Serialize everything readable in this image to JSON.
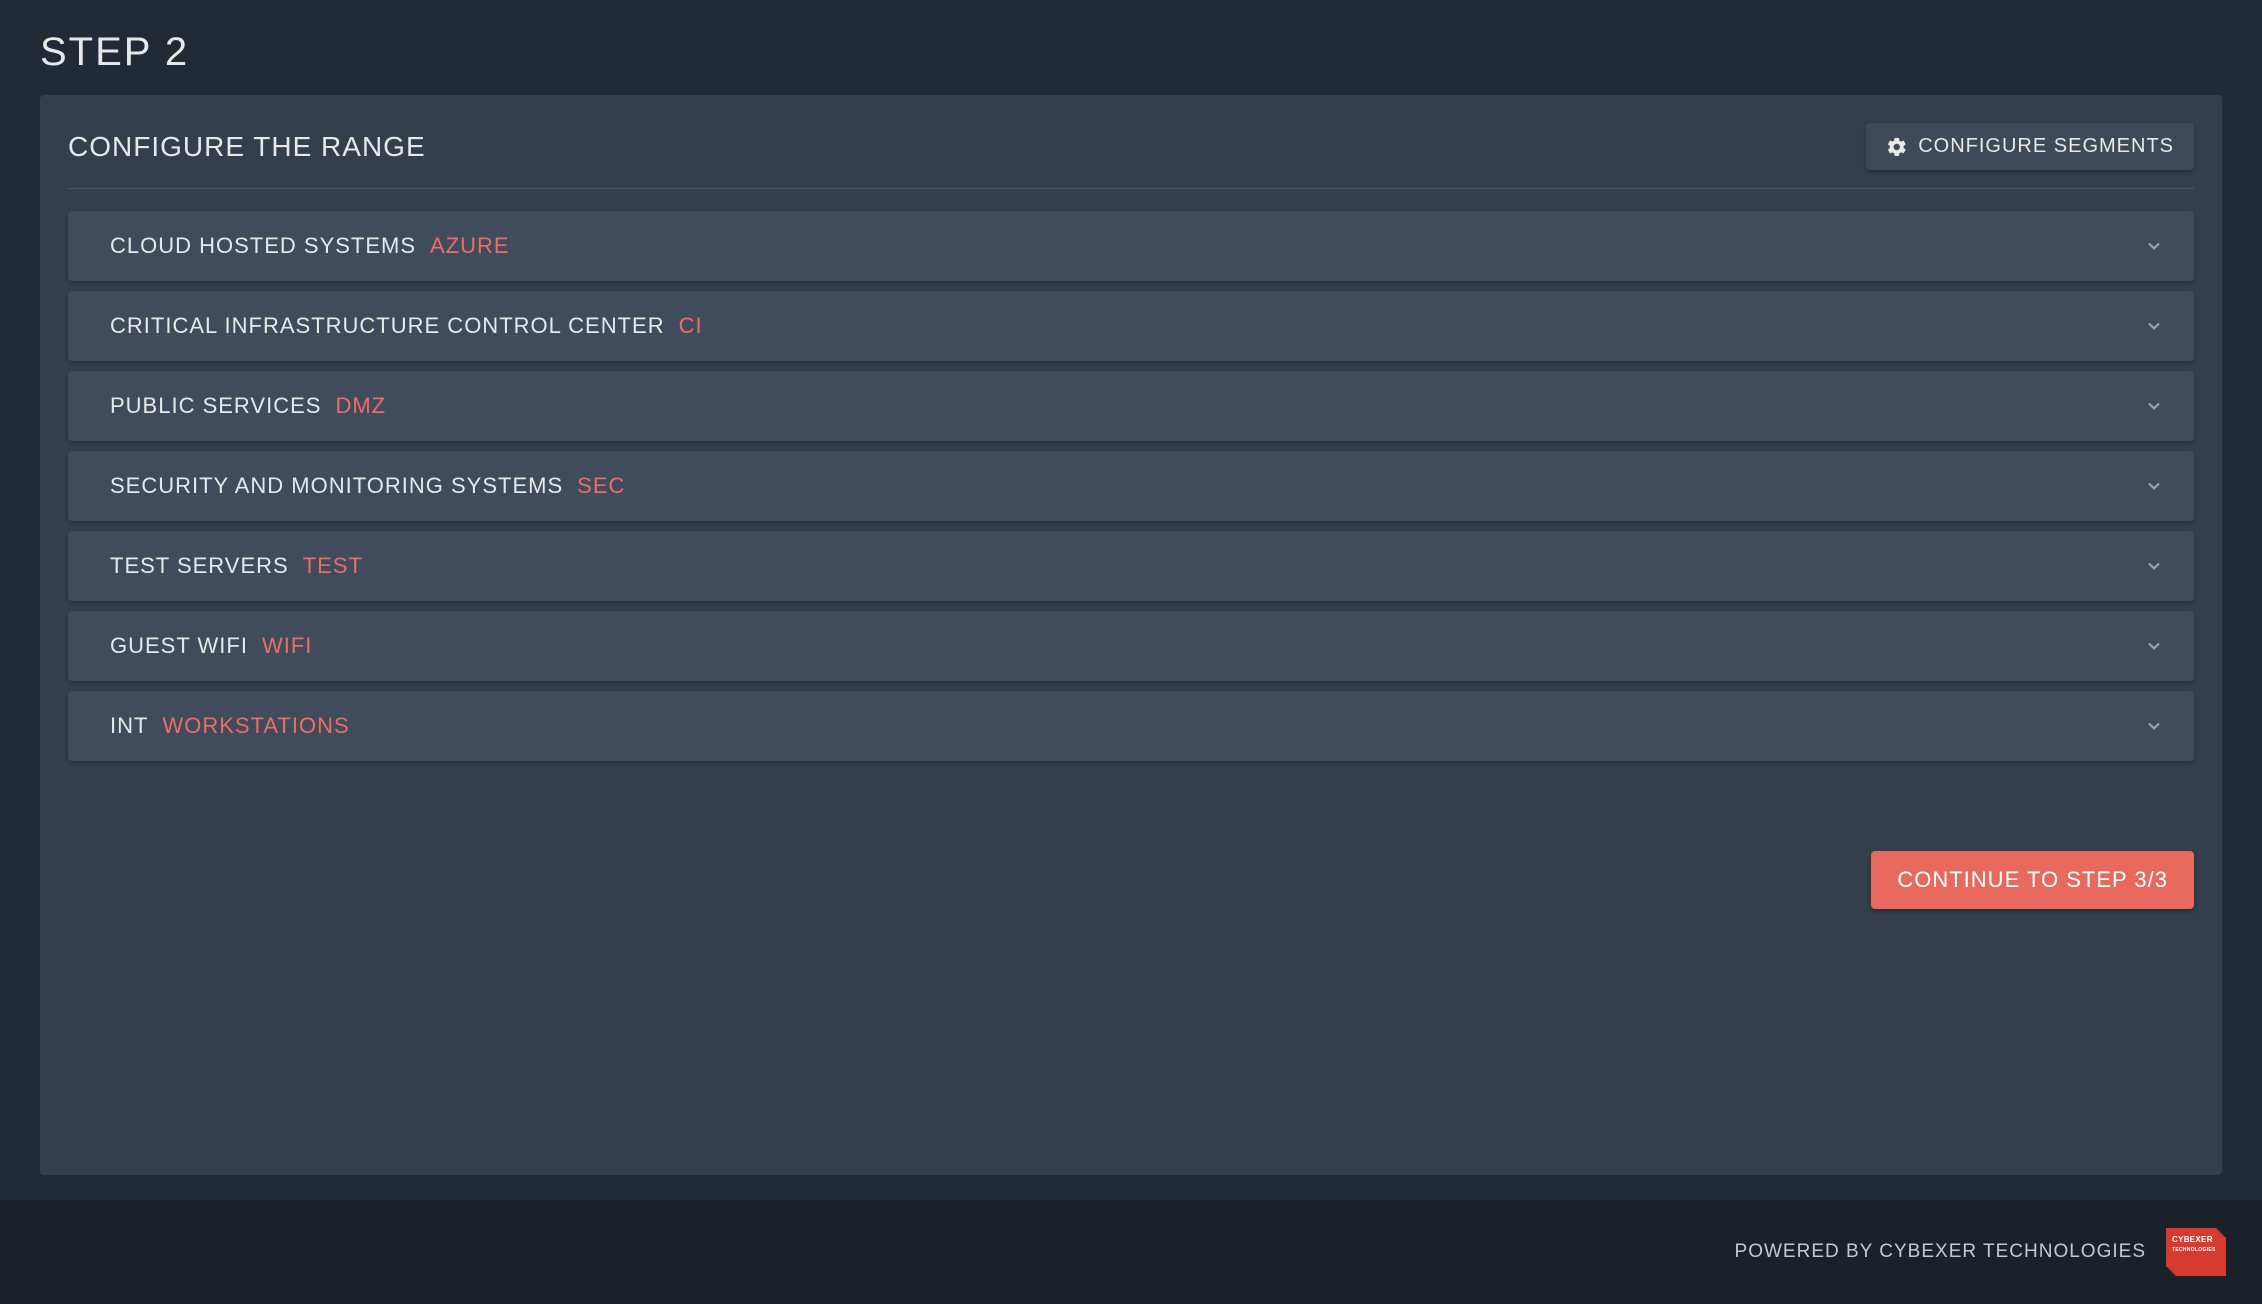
{
  "header": {
    "step_title": "STEP 2"
  },
  "panel": {
    "title": "CONFIGURE THE RANGE",
    "configure_segments_label": "CONFIGURE SEGMENTS"
  },
  "segments": [
    {
      "label": "CLOUD HOSTED SYSTEMS",
      "tag": "AZURE"
    },
    {
      "label": "CRITICAL INFRASTRUCTURE CONTROL CENTER",
      "tag": "CI"
    },
    {
      "label": "PUBLIC SERVICES",
      "tag": "DMZ"
    },
    {
      "label": "SECURITY AND MONITORING SYSTEMS",
      "tag": "SEC"
    },
    {
      "label": "TEST SERVERS",
      "tag": "TEST"
    },
    {
      "label": "GUEST WIFI",
      "tag": "WIFI"
    },
    {
      "label": "INT",
      "tag": "WORKSTATIONS"
    }
  ],
  "actions": {
    "continue_label": "CONTINUE TO STEP 3/3"
  },
  "footer": {
    "text": "POWERED BY CYBEXER TECHNOLOGIES",
    "logo_line1": "CYBEXER",
    "logo_line2": "TECHNOLOGIES"
  }
}
